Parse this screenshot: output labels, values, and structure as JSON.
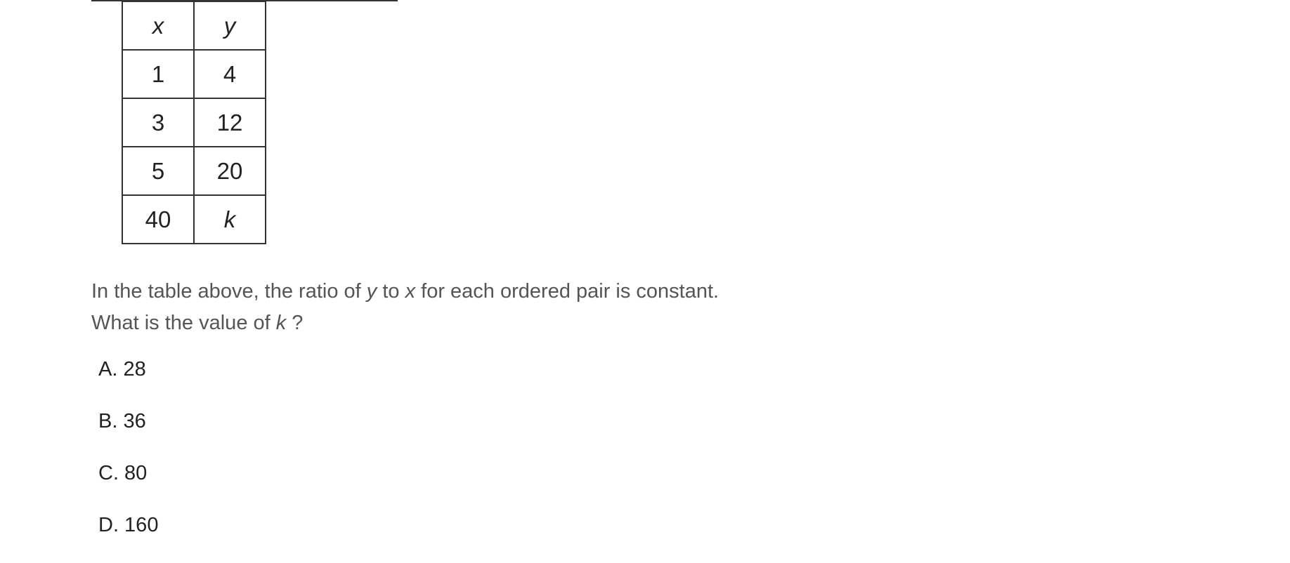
{
  "table": {
    "header": [
      "x",
      "y"
    ],
    "rows": [
      [
        "1",
        "4"
      ],
      [
        "3",
        "12"
      ],
      [
        "5",
        "20"
      ],
      [
        "40",
        "k"
      ]
    ]
  },
  "question": {
    "part1": "In the table above, the ratio of ",
    "var_y": "y",
    "part2": " to ",
    "var_x": "x",
    "part3": " for each ordered pair is constant. What is the value of ",
    "var_k": "k",
    "part4": " ?"
  },
  "choices": [
    {
      "label": "A. 28"
    },
    {
      "label": "B. 36"
    },
    {
      "label": "C. 80"
    },
    {
      "label": "D. 160"
    }
  ]
}
